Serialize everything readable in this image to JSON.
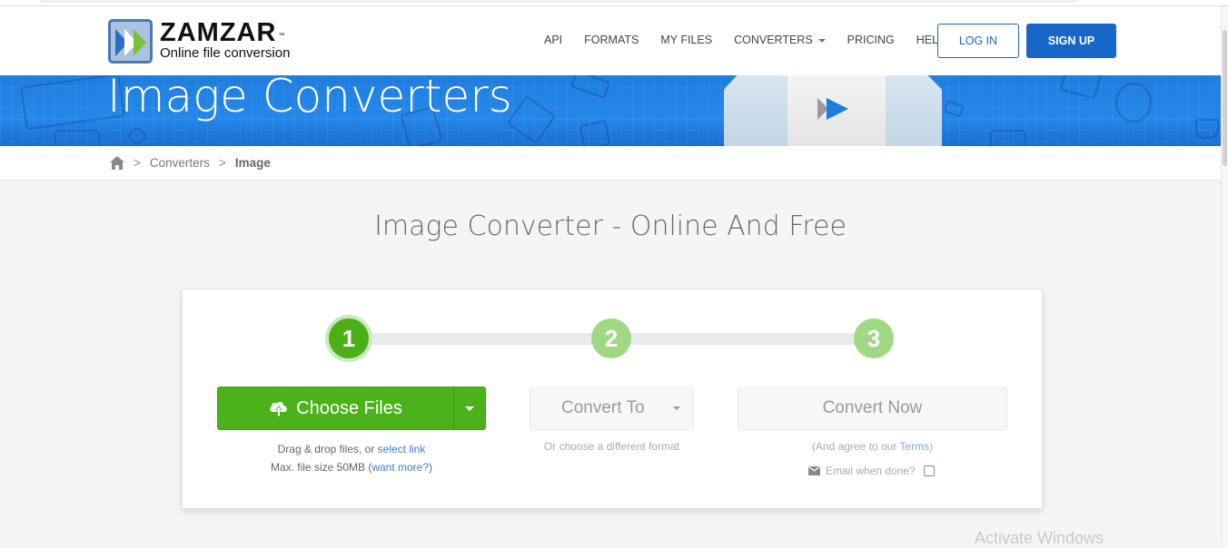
{
  "header": {
    "logo": {
      "name": "ZAMZAR",
      "trademark": "™",
      "tagline": "Online file conversion"
    },
    "nav": [
      {
        "label": "API"
      },
      {
        "label": "FORMATS"
      },
      {
        "label": "MY FILES"
      },
      {
        "label": "CONVERTERS",
        "has_dropdown": true
      },
      {
        "label": "PRICING"
      },
      {
        "label": "HELP"
      }
    ],
    "login_label": "LOG IN",
    "signup_label": "SIGN UP"
  },
  "banner": {
    "title": "Image Converters"
  },
  "breadcrumb": {
    "home_icon": "home-icon",
    "separator": ">",
    "items": [
      "Converters",
      "Image"
    ]
  },
  "main": {
    "heading": "Image Converter - Online And Free",
    "steps": [
      "1",
      "2",
      "3"
    ],
    "active_step": 1,
    "step1": {
      "button_label": "Choose Files",
      "icon": "cloud-upload-icon",
      "hint_prefix": "Drag & drop files, or ",
      "hint_link": "select link",
      "size_prefix": "Max. file size 50MB (",
      "size_link": "want more?",
      "size_suffix": ")"
    },
    "step2": {
      "select_label": "Convert To",
      "hint": "Or choose a different format"
    },
    "step3": {
      "button_label": "Convert Now",
      "terms_prefix": "(And agree to our ",
      "terms_link": "Terms",
      "terms_suffix": ")",
      "email_label": "Email when done?",
      "email_checked": false
    }
  },
  "colors": {
    "brand_blue": "#1667c8",
    "primary_green": "#4cb21a",
    "step_inactive_green": "#a1d884",
    "link_blue": "#3b7bd6"
  },
  "watermark": "Activate Windows"
}
